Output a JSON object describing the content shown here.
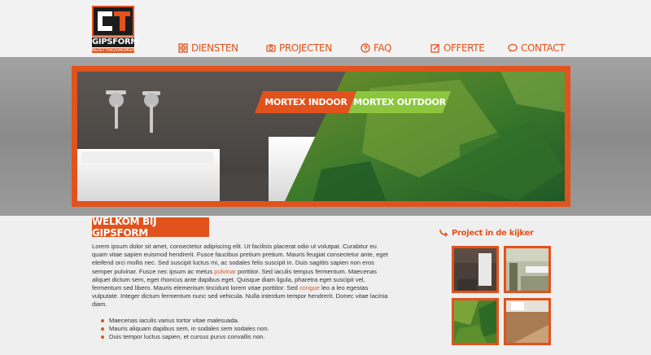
{
  "logo": {
    "name": "GIPSFORM",
    "subtitle": "BEZETTINGSWERKEN"
  },
  "nav": [
    {
      "label": "DIENSTEN",
      "icon": "grid-icon"
    },
    {
      "label": "PROJECTEN",
      "icon": "camera-icon"
    },
    {
      "label": "FAQ",
      "icon": "question-icon"
    },
    {
      "label": "OFFERTE",
      "icon": "edit-icon"
    },
    {
      "label": "CONTACT",
      "icon": "chat-icon"
    }
  ],
  "banner": {
    "btn_indoor": "MORTEX INDOOR",
    "btn_outdoor": "MORTEX OUTDOOR"
  },
  "content": {
    "heading": "WELKOM BIJ GIPSFORM",
    "para_a": "Lorem ipsum dolor sit amet, consectetur adipiscing elit. Ut facilisis placerat odio ut volutpat. Curabitur eu quam vitae sapien euismod hendrerit. Fusce faucibus pretium pretium. Mauris feugiat consectetur ante, eget eleifend orci mollis nec. Sed suscipit luctus mi, ac sodales felis suscipit in. Duis sagittis sapien non eros semper pulvinar. Fusce nec ipsum ac metus ",
    "link_a": "pulvinar",
    "para_b": " porttitor. Sed iaculis tempus fermentum. Maecenas aliquet dictum sem, eget rhoncus ante dapibus eget. Quisque diam ligula, pharetra eget suscipit vel, fermentum sed libero. Mauris elementum tincidunt lorem vitae porttitor. Sed ",
    "link_b": "congue",
    "para_c": " leo a leo egestas vulputate. Integer dictum fermentum nunc sed vehicula. Nulla interdum tempor hendrerit. Donec vitae lacinia diam.",
    "bullets": [
      "Maecenas iaculis varius tortor vitae malesuada.",
      "Mauris aliquam dapibus sem, in sodales sem sodales non.",
      "Duis tempor luctus sapien, et cursus purus convallis non."
    ]
  },
  "project": {
    "title": "Project in de kijker"
  },
  "colors": {
    "accent": "#e2521c",
    "green": "#8cc63f",
    "dark": "#1c1c1c"
  }
}
